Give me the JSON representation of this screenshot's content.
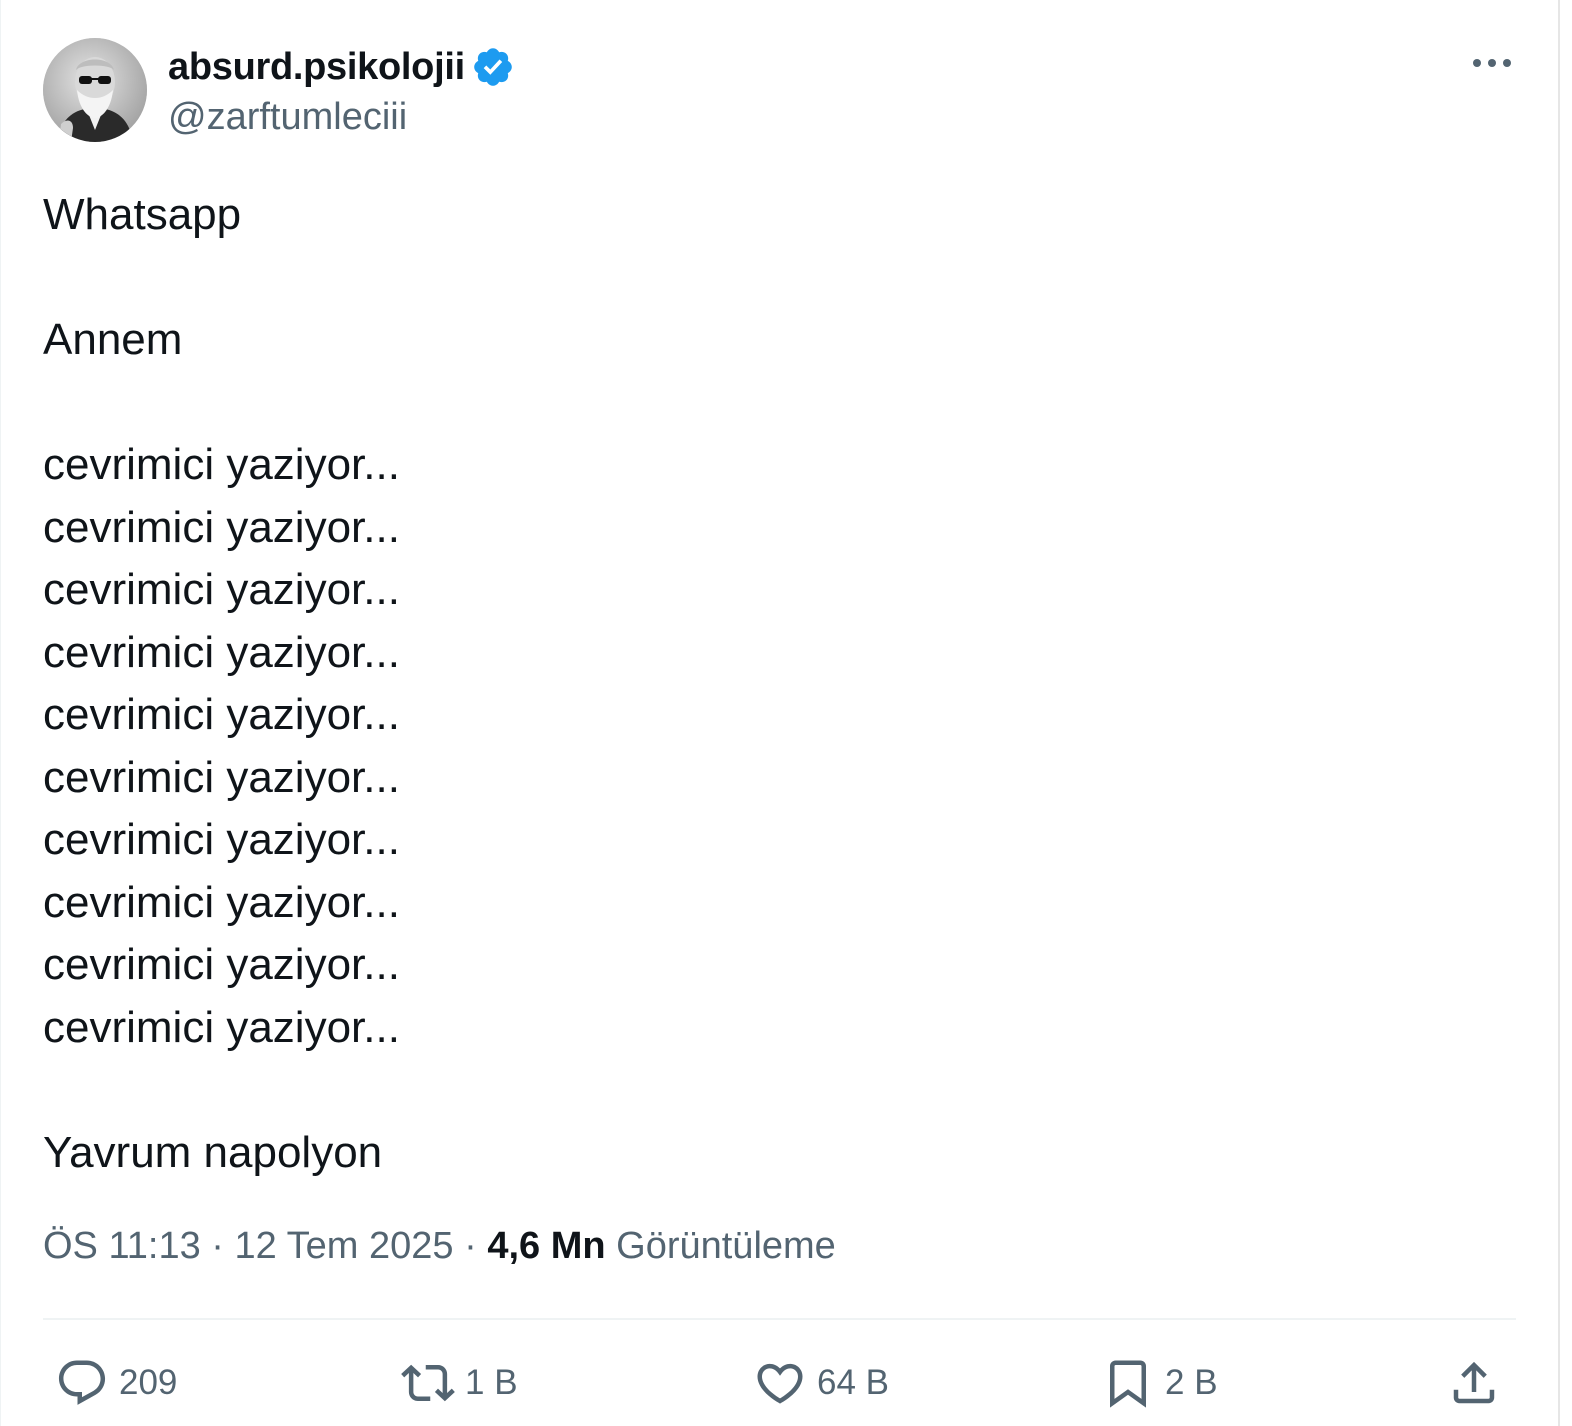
{
  "author": {
    "display_name": "absurd.psikolojii",
    "handle": "@zarftumleciii",
    "verified_badge_icon": "verified-check-icon",
    "verified_color": "#1d9bf0"
  },
  "post": {
    "lines": [
      "Whatsapp",
      "",
      "Annem",
      "",
      "cevrimici yaziyor...",
      "cevrimici yaziyor...",
      "cevrimici yaziyor...",
      "cevrimici yaziyor...",
      "cevrimici yaziyor...",
      "cevrimici yaziyor...",
      "cevrimici yaziyor...",
      "cevrimici yaziyor...",
      "cevrimici yaziyor...",
      "cevrimici yaziyor...",
      "",
      "Yavrum napolyon"
    ]
  },
  "meta": {
    "time": "ÖS 11:13",
    "separator": " · ",
    "date": "12 Tem 2025",
    "views_count": "4,6 Mn",
    "views_label": "Görüntüleme"
  },
  "actions": {
    "replies": {
      "icon": "reply-icon",
      "count": "209"
    },
    "reposts": {
      "icon": "repost-icon",
      "count": "1 B"
    },
    "likes": {
      "icon": "heart-icon",
      "count": "64 B"
    },
    "bookmarks": {
      "icon": "bookmark-icon",
      "count": "2 B"
    },
    "share": {
      "icon": "share-icon"
    }
  },
  "colors": {
    "text_primary": "#0f1419",
    "text_secondary": "#536471",
    "divider": "#eff3f4"
  }
}
